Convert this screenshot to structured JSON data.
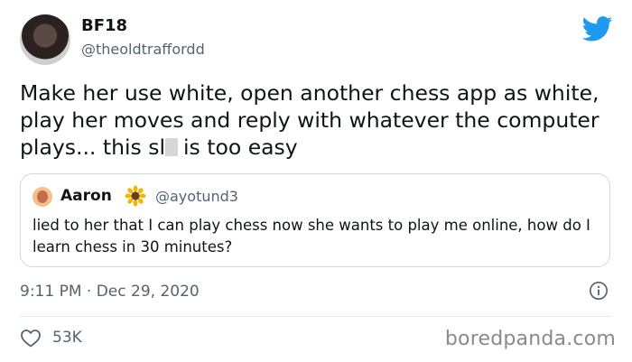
{
  "author": {
    "display_name": "BF18",
    "handle": "@theoldtraffordd"
  },
  "tweet": {
    "text_before_censor": "Make her use white, open another chess app as white, play her moves and reply with whatever the computer plays... this sl",
    "text_after_censor": "is too easy"
  },
  "quoted_tweet": {
    "display_name": "Aaron",
    "handle": "@ayotund3",
    "text": "lied to her that I can play chess now she wants to play me online, how do I learn chess in 30 minutes?"
  },
  "meta": {
    "timestamp": "9:11 PM · Dec 29, 2020",
    "like_count": "53K"
  },
  "watermark": "boredpanda.com",
  "colors": {
    "twitter_blue": "#1d9bf0",
    "secondary_text": "#536471",
    "border": "#cfd9de"
  }
}
